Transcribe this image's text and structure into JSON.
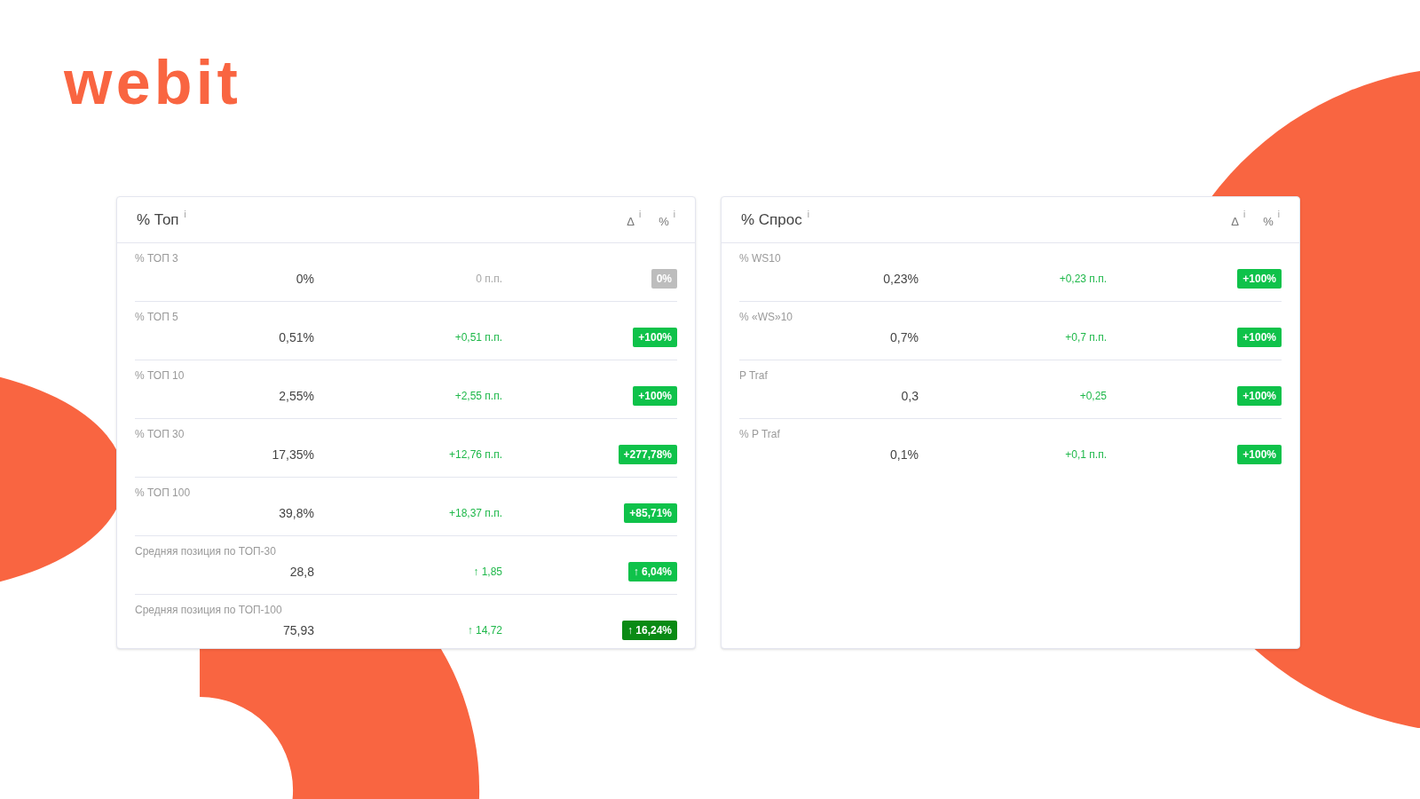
{
  "logo": "webit",
  "panels": [
    {
      "title": "% Топ",
      "title_info": "i",
      "columns": [
        {
          "label": "Δ",
          "info": "i"
        },
        {
          "label": "%",
          "info": "i"
        }
      ],
      "rows": [
        {
          "label": "% ТОП 3",
          "value": "0%",
          "delta": {
            "text": "0 п.п.",
            "color": "#a8a8a8"
          },
          "change": {
            "text": "0%",
            "color": "#bdbdbd"
          }
        },
        {
          "label": "% ТОП 5",
          "value": "0,51%",
          "delta": {
            "text": "+0,51 п.п.",
            "color": "#1fb84a"
          },
          "change": {
            "text": "+100%",
            "color": "#0fc24a"
          }
        },
        {
          "label": "% ТОП 10",
          "value": "2,55%",
          "delta": {
            "text": "+2,55 п.п.",
            "color": "#1fb84a"
          },
          "change": {
            "text": "+100%",
            "color": "#0fc24a"
          }
        },
        {
          "label": "% ТОП 30",
          "value": "17,35%",
          "delta": {
            "text": "+12,76 п.п.",
            "color": "#1fb84a"
          },
          "change": {
            "text": "+277,78%",
            "color": "#0fc24a"
          }
        },
        {
          "label": "% ТОП 100",
          "value": "39,8%",
          "delta": {
            "text": "+18,37 п.п.",
            "color": "#1fb84a"
          },
          "change": {
            "text": "+85,71%",
            "color": "#0fc24a"
          }
        },
        {
          "label": "Средняя позиция по ТОП-30",
          "value": "28,8",
          "delta": {
            "text": "↑ 1,85",
            "color": "#1fb84a"
          },
          "change": {
            "text": "↑ 6,04%",
            "color": "#0fc24a"
          }
        },
        {
          "label": "Средняя позиция по ТОП-100",
          "value": "75,93",
          "delta": {
            "text": "↑ 14,72",
            "color": "#1fb84a"
          },
          "change": {
            "text": "↑ 16,24%",
            "color": "#0a8a14"
          }
        }
      ]
    },
    {
      "title": "% Спрос",
      "title_info": "i",
      "columns": [
        {
          "label": "Δ",
          "info": "i"
        },
        {
          "label": "%",
          "info": "i"
        }
      ],
      "rows": [
        {
          "label": "% WS10",
          "value": "0,23%",
          "delta": {
            "text": "+0,23 п.п.",
            "color": "#1fb84a"
          },
          "change": {
            "text": "+100%",
            "color": "#0fc24a"
          }
        },
        {
          "label": "% «WS»10",
          "value": "0,7%",
          "delta": {
            "text": "+0,7 п.п.",
            "color": "#1fb84a"
          },
          "change": {
            "text": "+100%",
            "color": "#0fc24a"
          }
        },
        {
          "label": "P Traf",
          "value": "0,3",
          "delta": {
            "text": "+0,25",
            "color": "#1fb84a"
          },
          "change": {
            "text": "+100%",
            "color": "#0fc24a"
          }
        },
        {
          "label": "% P Traf",
          "value": "0,1%",
          "delta": {
            "text": "+0,1 п.п.",
            "color": "#1fb84a"
          },
          "change": {
            "text": "+100%",
            "color": "#0fc24a"
          }
        }
      ]
    }
  ]
}
